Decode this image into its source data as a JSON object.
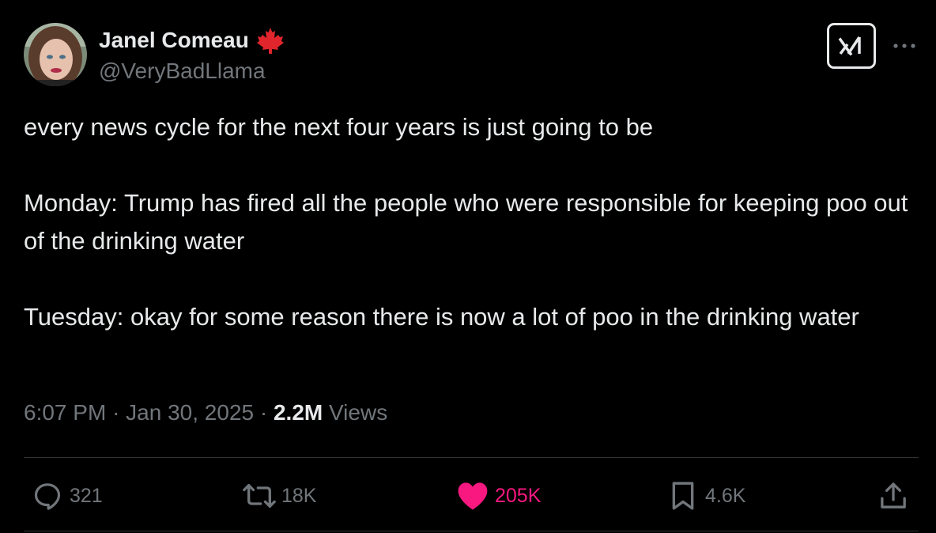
{
  "author": {
    "name": "Janel Comeau",
    "handle": "@VeryBadLlama",
    "flag_icon": "maple-leaf-icon",
    "avatar_icon": "avatar"
  },
  "header": {
    "grok_icon": "grok-icon",
    "more_icon": "more-icon"
  },
  "tweet": {
    "paragraphs": [
      "every news cycle for the next four years is just going to be",
      "Monday: Trump has fired all the people who were responsible for keeping poo out of the drinking water",
      "Tuesday: okay for some reason there is now a lot of poo in the drinking water"
    ]
  },
  "meta": {
    "time": "6:07 PM",
    "separator": "·",
    "date": "Jan 30, 2025",
    "views_count": "2.2M",
    "views_label": "Views"
  },
  "actions": {
    "reply": {
      "icon": "reply-icon",
      "count": "321"
    },
    "repost": {
      "icon": "repost-icon",
      "count": "18K"
    },
    "like": {
      "icon": "heart-icon",
      "count": "205K",
      "liked": true
    },
    "bookmark": {
      "icon": "bookmark-icon",
      "count": "4.6K"
    },
    "share": {
      "icon": "share-icon"
    }
  },
  "colors": {
    "background": "#000000",
    "primary_text": "#e7e9ea",
    "secondary_text": "#71767b",
    "like_pink": "#f91880",
    "flag_red": "#e0252c",
    "divider": "#2f3336"
  }
}
